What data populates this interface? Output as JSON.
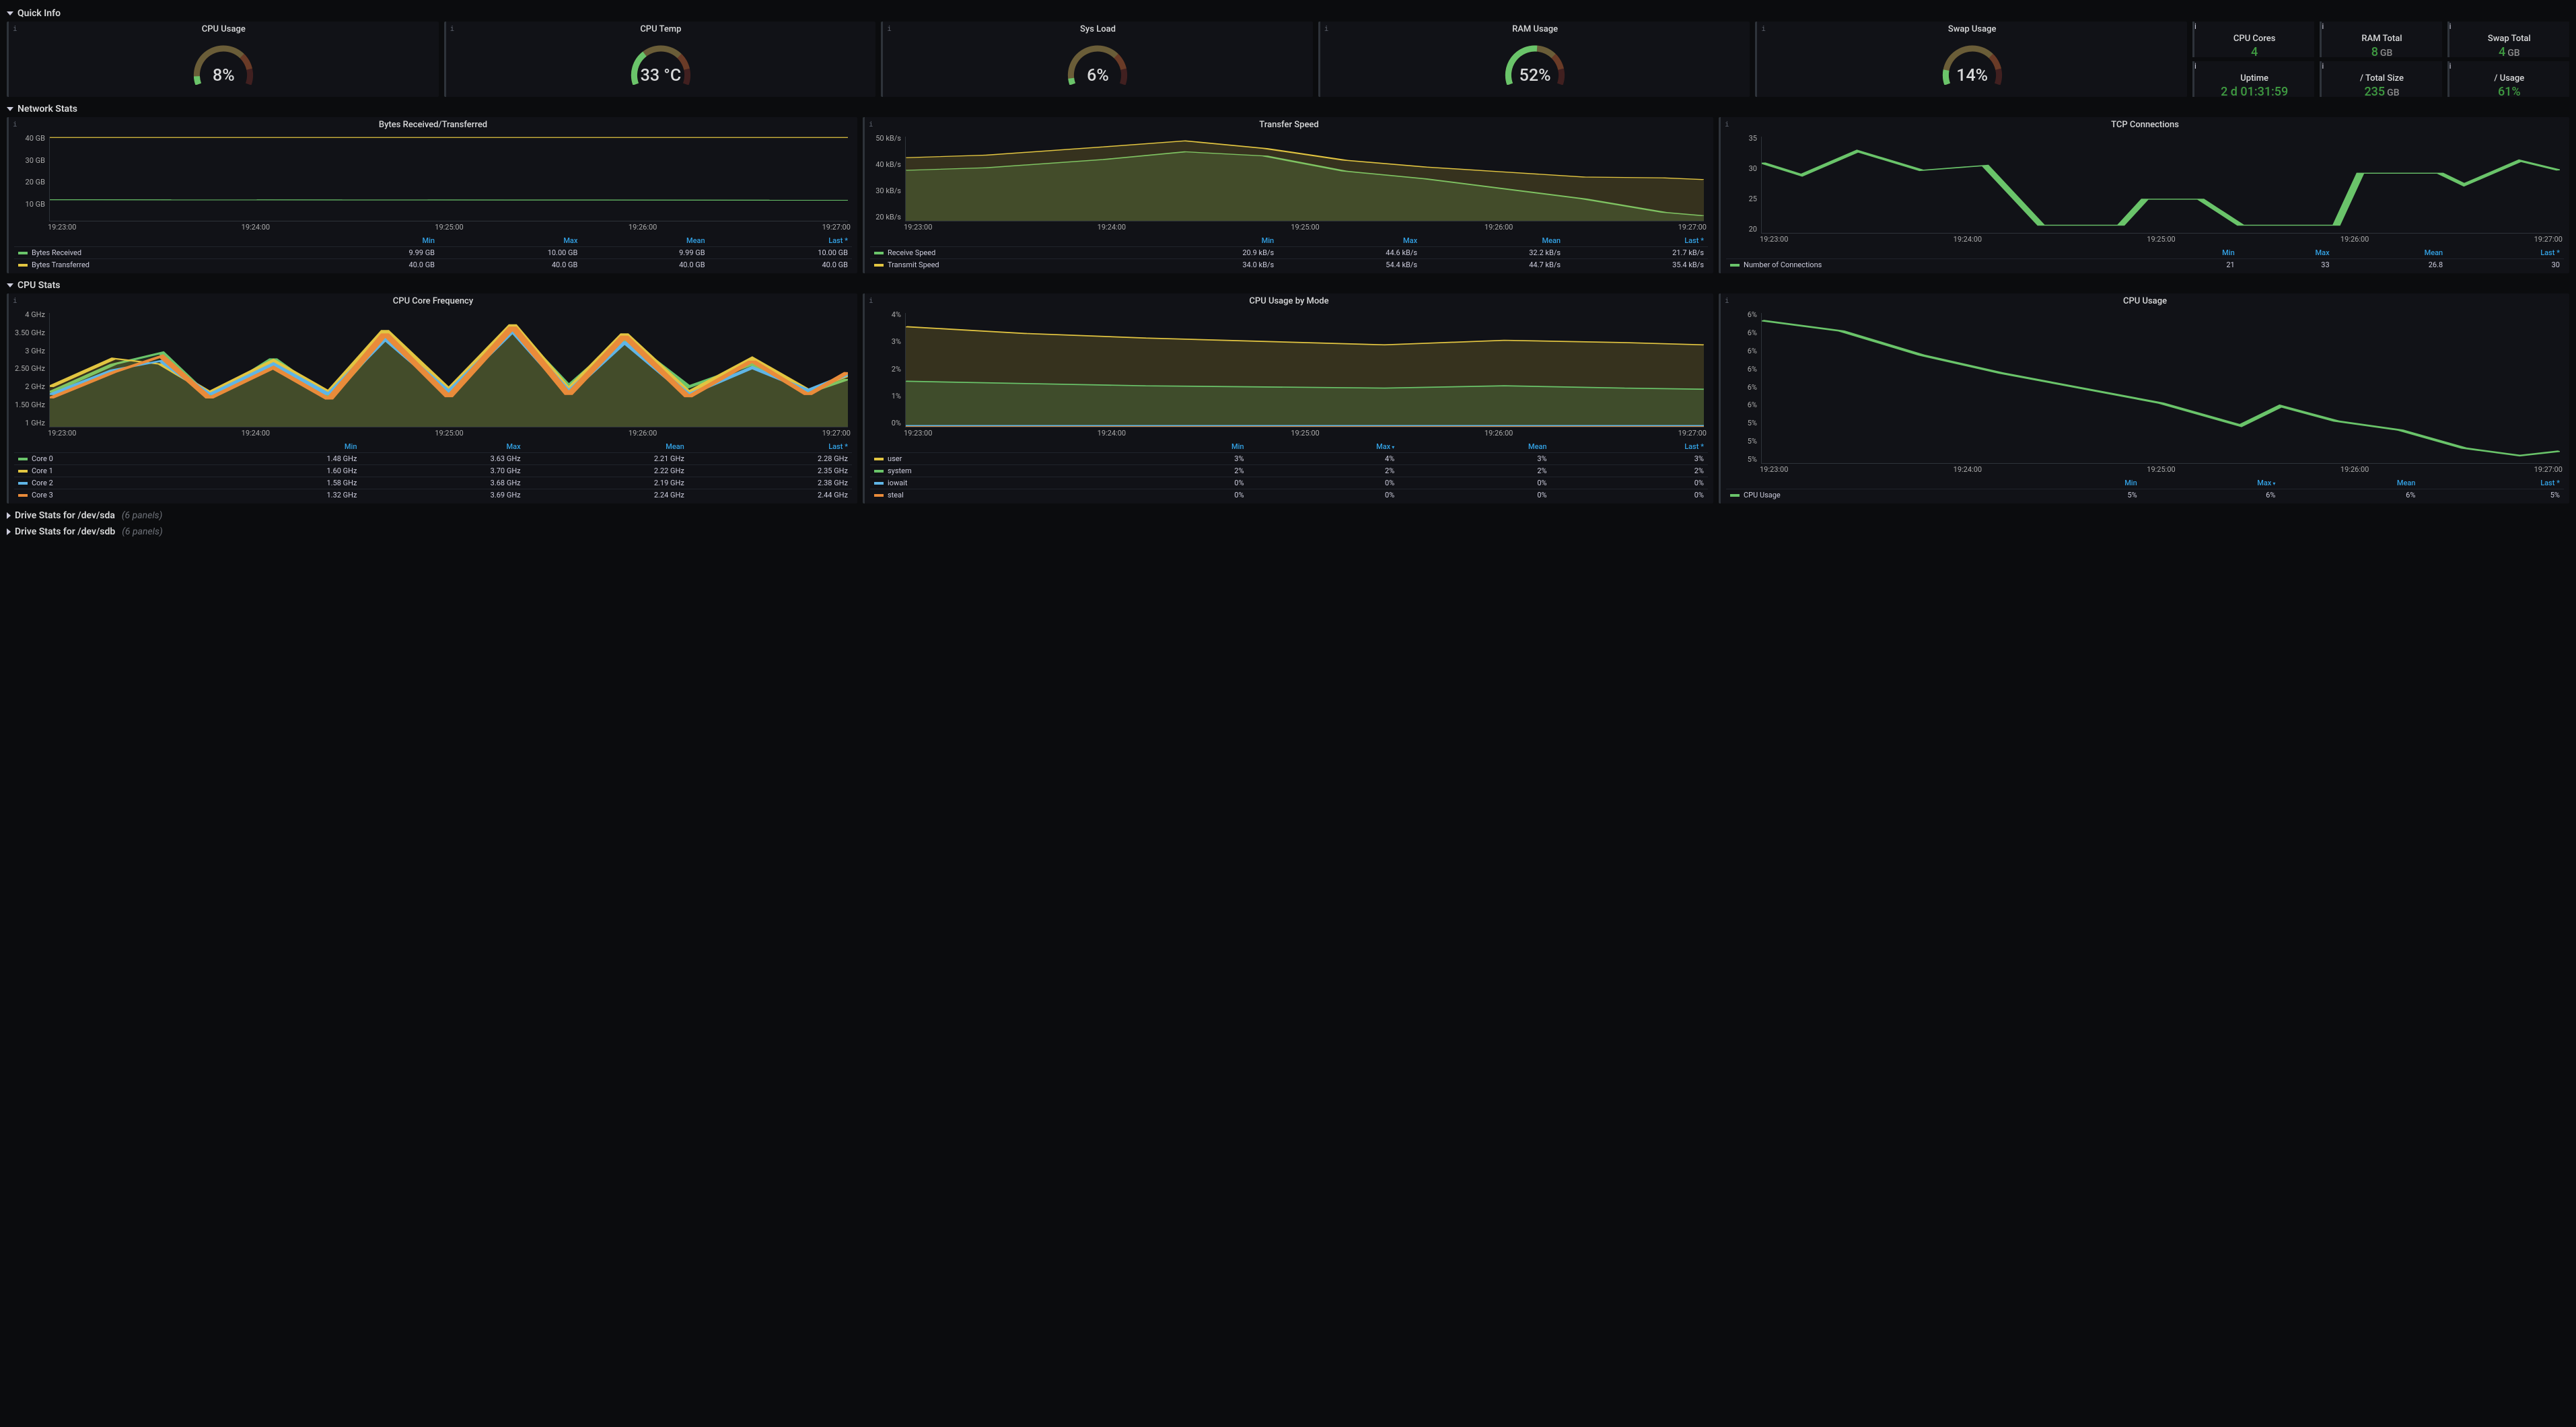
{
  "rows": {
    "quick": {
      "title": "Quick Info"
    },
    "network": {
      "title": "Network Stats"
    },
    "cpu": {
      "title": "CPU Stats"
    },
    "drv_a": {
      "title": "Drive Stats for /dev/sda",
      "hint": "(6 panels)"
    },
    "drv_b": {
      "title": "Drive Stats for /dev/sdb",
      "hint": "(6 panels)"
    }
  },
  "gauges": {
    "cpu_usage": {
      "title": "CPU Usage",
      "value": "8%",
      "frac": 0.08
    },
    "cpu_temp": {
      "title": "CPU Temp",
      "value": "33 °C",
      "frac": 0.33
    },
    "sys_load": {
      "title": "Sys Load",
      "value": "6%",
      "frac": 0.06
    },
    "ram_usage": {
      "title": "RAM Usage",
      "value": "52%",
      "frac": 0.52
    },
    "swap_usage": {
      "title": "Swap Usage",
      "value": "14%",
      "frac": 0.14
    }
  },
  "stats": {
    "cores": {
      "label": "CPU Cores",
      "value": "4",
      "unit": ""
    },
    "ram": {
      "label": "RAM Total",
      "value": "8",
      "unit": "GB"
    },
    "swap": {
      "label": "Swap Total",
      "value": "4",
      "unit": "GB"
    },
    "uptime": {
      "label": "Uptime",
      "value": "2 d 01:31:59",
      "unit": ""
    },
    "tsize": {
      "label": "/ Total Size",
      "value": "235",
      "unit": "GB"
    },
    "tusage": {
      "label": "/ Usage",
      "value": "61%",
      "unit": ""
    }
  },
  "headers": {
    "min": "Min",
    "max": "Max",
    "mean": "Mean",
    "last": "Last *"
  },
  "x_ticks_5": [
    "19:23:00",
    "19:24:00",
    "19:25:00",
    "19:26:00",
    "19:27:00"
  ],
  "chart_data": [
    {
      "id": "bytes",
      "title": "Bytes Received/Transferred",
      "type": "line",
      "y_ticks": [
        "40 GB",
        "30 GB",
        "20 GB",
        "10 GB",
        ""
      ],
      "series": [
        {
          "name": "Bytes Received",
          "color": "#6ac46a",
          "min": "9.99 GB",
          "max": "10.00 GB",
          "mean": "9.99 GB",
          "last": "10.00 GB",
          "pts": [
            [
              0,
              25
            ],
            [
              100,
              24.5
            ]
          ]
        },
        {
          "name": "Bytes Transferred",
          "color": "#e2c541",
          "min": "40.0 GB",
          "max": "40.0 GB",
          "mean": "40.0 GB",
          "last": "40.0 GB",
          "pts": [
            [
              0,
              99
            ],
            [
              100,
              99
            ]
          ]
        }
      ]
    },
    {
      "id": "speed",
      "title": "Transfer Speed",
      "type": "line",
      "y_ticks": [
        "50 kB/s",
        "40 kB/s",
        "30 kB/s",
        "20 kB/s"
      ],
      "series": [
        {
          "name": "Receive Speed",
          "color": "#6ac46a",
          "min": "20.9 kB/s",
          "max": "44.6 kB/s",
          "mean": "32.2 kB/s",
          "last": "21.7 kB/s",
          "pts": [
            [
              0,
              60
            ],
            [
              10,
              63
            ],
            [
              25,
              73
            ],
            [
              35,
              82
            ],
            [
              45,
              77
            ],
            [
              55,
              59
            ],
            [
              65,
              50
            ],
            [
              75,
              38
            ],
            [
              85,
              26
            ],
            [
              95,
              10
            ],
            [
              100,
              6
            ]
          ],
          "fill": true
        },
        {
          "name": "Transmit Speed",
          "color": "#e2c541",
          "min": "34.0 kB/s",
          "max": "54.4 kB/s",
          "mean": "44.7 kB/s",
          "last": "35.4 kB/s",
          "pts": [
            [
              0,
              75
            ],
            [
              10,
              78
            ],
            [
              25,
              88
            ],
            [
              35,
              95
            ],
            [
              45,
              86
            ],
            [
              55,
              72
            ],
            [
              65,
              64
            ],
            [
              75,
              58
            ],
            [
              85,
              52
            ],
            [
              95,
              51
            ],
            [
              100,
              49
            ]
          ],
          "fill": true
        }
      ]
    },
    {
      "id": "tcp",
      "title": "TCP Connections",
      "type": "line",
      "y_ticks": [
        "35",
        "30",
        "25",
        "20"
      ],
      "series": [
        {
          "name": "Number of Connections",
          "color": "#6ac46a",
          "min": "21",
          "max": "33",
          "mean": "26.8",
          "last": "30",
          "pts": [
            [
              0,
              73
            ],
            [
              5,
              60
            ],
            [
              12,
              85
            ],
            [
              20,
              65
            ],
            [
              28,
              70
            ],
            [
              35,
              8
            ],
            [
              45,
              8
            ],
            [
              48,
              35
            ],
            [
              55,
              35
            ],
            [
              60,
              8
            ],
            [
              72,
              8
            ],
            [
              75,
              62
            ],
            [
              85,
              62
            ],
            [
              88,
              50
            ],
            [
              95,
              75
            ],
            [
              100,
              65
            ]
          ]
        }
      ]
    },
    {
      "id": "cpufreq",
      "title": "CPU Core Frequency",
      "type": "line",
      "y_ticks": [
        "4 GHz",
        "3.50 GHz",
        "3 GHz",
        "2.50 GHz",
        "2 GHz",
        "1.50 GHz",
        "1 GHz"
      ],
      "series": [
        {
          "name": "Core 0",
          "color": "#6ac46a",
          "min": "1.48 GHz",
          "max": "3.63 GHz",
          "mean": "2.21 GHz",
          "last": "2.28 GHz",
          "pts": [
            [
              0,
              30
            ],
            [
              8,
              55
            ],
            [
              14,
              65
            ],
            [
              20,
              25
            ],
            [
              28,
              60
            ],
            [
              35,
              25
            ],
            [
              42,
              80
            ],
            [
              50,
              30
            ],
            [
              58,
              87
            ],
            [
              65,
              35
            ],
            [
              72,
              78
            ],
            [
              80,
              35
            ],
            [
              88,
              55
            ],
            [
              95,
              30
            ],
            [
              100,
              42
            ]
          ],
          "fill": true
        },
        {
          "name": "Core 1",
          "color": "#e2c541",
          "min": "1.60 GHz",
          "max": "3.70 GHz",
          "mean": "2.22 GHz",
          "last": "2.35 GHz",
          "pts": [
            [
              0,
              35
            ],
            [
              8,
              60
            ],
            [
              14,
              55
            ],
            [
              20,
              30
            ],
            [
              28,
              58
            ],
            [
              35,
              30
            ],
            [
              42,
              85
            ],
            [
              50,
              32
            ],
            [
              58,
              90
            ],
            [
              65,
              32
            ],
            [
              72,
              82
            ],
            [
              80,
              30
            ],
            [
              88,
              60
            ],
            [
              95,
              32
            ],
            [
              100,
              45
            ]
          ],
          "fill": true
        },
        {
          "name": "Core 2",
          "color": "#5fb5e6",
          "min": "1.58 GHz",
          "max": "3.68 GHz",
          "mean": "2.19 GHz",
          "last": "2.38 GHz",
          "pts": [
            [
              0,
              28
            ],
            [
              8,
              50
            ],
            [
              14,
              58
            ],
            [
              20,
              28
            ],
            [
              28,
              55
            ],
            [
              35,
              28
            ],
            [
              42,
              78
            ],
            [
              50,
              30
            ],
            [
              58,
              85
            ],
            [
              65,
              30
            ],
            [
              72,
              75
            ],
            [
              80,
              28
            ],
            [
              88,
              52
            ],
            [
              95,
              32
            ],
            [
              100,
              46
            ]
          ]
        },
        {
          "name": "Core 3",
          "color": "#e98b3a",
          "min": "1.32 GHz",
          "max": "3.69 GHz",
          "mean": "2.24 GHz",
          "last": "2.44 GHz",
          "pts": [
            [
              0,
              25
            ],
            [
              8,
              48
            ],
            [
              14,
              62
            ],
            [
              20,
              25
            ],
            [
              28,
              52
            ],
            [
              35,
              24
            ],
            [
              42,
              82
            ],
            [
              50,
              26
            ],
            [
              58,
              88
            ],
            [
              65,
              28
            ],
            [
              72,
              80
            ],
            [
              80,
              26
            ],
            [
              88,
              58
            ],
            [
              95,
              28
            ],
            [
              100,
              48
            ]
          ]
        }
      ]
    },
    {
      "id": "cpumode",
      "title": "CPU Usage by Mode",
      "type": "area",
      "y_ticks": [
        "4%",
        "3%",
        "2%",
        "1%",
        "0%"
      ],
      "series": [
        {
          "name": "user",
          "color": "#e2c541",
          "min": "3%",
          "max": "4%",
          "mean": "3%",
          "last": "3%",
          "pts": [
            [
              0,
              88
            ],
            [
              15,
              82
            ],
            [
              30,
              78
            ],
            [
              45,
              75
            ],
            [
              60,
              72
            ],
            [
              75,
              76
            ],
            [
              90,
              74
            ],
            [
              100,
              72
            ]
          ],
          "fill": true,
          "offset": 0
        },
        {
          "name": "system",
          "color": "#6ac46a",
          "min": "2%",
          "max": "2%",
          "mean": "2%",
          "last": "2%",
          "pts": [
            [
              0,
              40
            ],
            [
              15,
              38
            ],
            [
              30,
              36
            ],
            [
              45,
              35
            ],
            [
              60,
              34
            ],
            [
              75,
              36
            ],
            [
              90,
              34
            ],
            [
              100,
              33
            ]
          ],
          "fill": true,
          "offset": 0
        },
        {
          "name": "iowait",
          "color": "#5fb5e6",
          "min": "0%",
          "max": "0%",
          "mean": "0%",
          "last": "0%",
          "pts": [
            [
              0,
              1
            ],
            [
              100,
              1
            ]
          ]
        },
        {
          "name": "steal",
          "color": "#e98b3a",
          "min": "0%",
          "max": "0%",
          "mean": "0%",
          "last": "0%",
          "pts": [
            [
              0,
              0
            ],
            [
              100,
              0
            ]
          ]
        }
      ]
    },
    {
      "id": "cpuusage",
      "title": "CPU Usage",
      "type": "line",
      "y_ticks": [
        "6%",
        "6%",
        "6%",
        "6%",
        "6%",
        "6%",
        "5%",
        "5%",
        "5%"
      ],
      "series": [
        {
          "name": "CPU Usage",
          "color": "#6ac46a",
          "min": "5%",
          "max": "6%",
          "mean": "6%",
          "last": "5%",
          "pts": [
            [
              0,
              95
            ],
            [
              10,
              88
            ],
            [
              20,
              72
            ],
            [
              30,
              60
            ],
            [
              40,
              50
            ],
            [
              50,
              40
            ],
            [
              60,
              25
            ],
            [
              65,
              38
            ],
            [
              72,
              28
            ],
            [
              80,
              22
            ],
            [
              88,
              10
            ],
            [
              95,
              5
            ],
            [
              100,
              8
            ]
          ]
        }
      ]
    }
  ]
}
